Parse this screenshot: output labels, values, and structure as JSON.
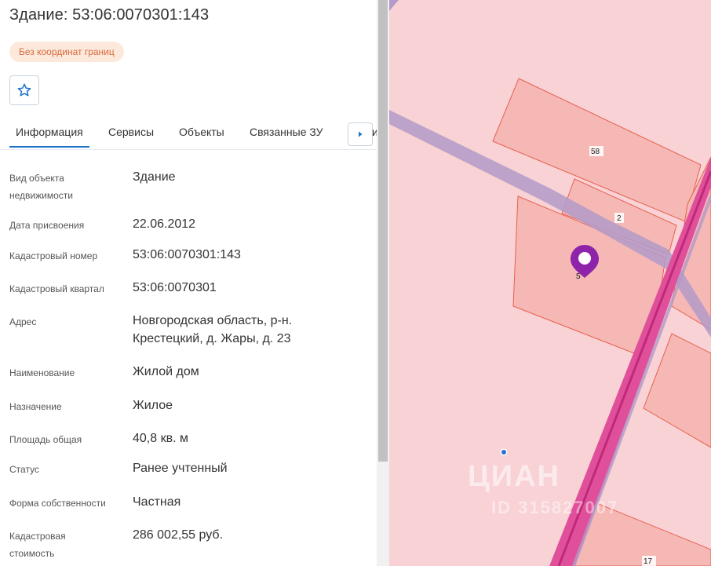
{
  "object": {
    "title": "Здание: 53:06:0070301:143",
    "badge": "Без координат границ",
    "favorite_icon": "star-icon"
  },
  "tabs": [
    {
      "label": "Информация",
      "active": true
    },
    {
      "label": "Сервисы"
    },
    {
      "label": "Объекты"
    },
    {
      "label": "Связанные ЗУ"
    }
  ],
  "tab_next_icon": "chevron-right-icon",
  "tab_overflow": "и",
  "info": [
    {
      "label": "Вид объекта недвижимости",
      "value": "Здание"
    },
    {
      "label": "Дата присвоения",
      "value": "22.06.2012"
    },
    {
      "label": "Кадастровый номер",
      "value": "53:06:0070301:143"
    },
    {
      "label": "Кадастровый квартал",
      "value": "53:06:0070301"
    },
    {
      "label": "Адрес",
      "value": "Новгородская область, р-н. Крестецкий, д. Жары, д. 23"
    },
    {
      "label": "Наименование",
      "value": "Жилой дом"
    },
    {
      "label": "Назначение",
      "value": "Жилое"
    },
    {
      "label": "Площадь общая",
      "value": "40,8 кв. м"
    },
    {
      "label": "Статус",
      "value": "Ранее учтенный"
    },
    {
      "label": "Форма собственности",
      "value": "Частная"
    },
    {
      "label": "Кадастровая стоимость",
      "value": "286 002,55 руб."
    }
  ],
  "map": {
    "parcels": [
      "58",
      "2",
      "5",
      "17"
    ],
    "marker_icon": "location-pin-icon",
    "watermark": "ЦИАН",
    "watermark_id": "ID 315827007",
    "colors": {
      "background": "#f9d2d6",
      "parcel_fill": "#f5b8b5",
      "parcel_stroke": "#e8604e",
      "road": "#b39ac8",
      "highway": "#e0509a",
      "marker": "#8e24aa"
    }
  }
}
